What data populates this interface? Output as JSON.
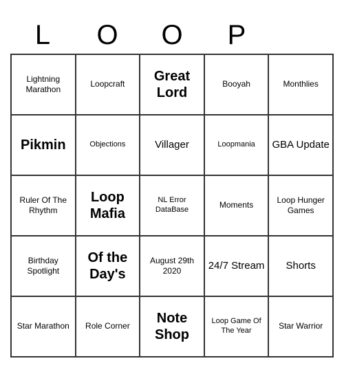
{
  "header": {
    "letters": [
      "L",
      "O",
      "O",
      "P",
      ""
    ]
  },
  "cells": [
    [
      {
        "text": "Lightning Marathon",
        "size": "size-small"
      },
      {
        "text": "Loopcraft",
        "size": "size-small"
      },
      {
        "text": "Great Lord",
        "size": "size-large"
      },
      {
        "text": "Booyah",
        "size": "size-small"
      },
      {
        "text": "Monthlies",
        "size": "size-small"
      }
    ],
    [
      {
        "text": "Pikmin",
        "size": "size-large"
      },
      {
        "text": "Objections",
        "size": "size-xsmall"
      },
      {
        "text": "Villager",
        "size": "size-medium"
      },
      {
        "text": "Loopmania",
        "size": "size-xsmall"
      },
      {
        "text": "GBA Update",
        "size": "size-medium"
      }
    ],
    [
      {
        "text": "Ruler Of The Rhythm",
        "size": "size-small"
      },
      {
        "text": "Loop Mafia",
        "size": "size-large"
      },
      {
        "text": "NL Error DataBase",
        "size": "size-xsmall"
      },
      {
        "text": "Moments",
        "size": "size-small"
      },
      {
        "text": "Loop Hunger Games",
        "size": "size-small"
      }
    ],
    [
      {
        "text": "Birthday Spotlight",
        "size": "size-small"
      },
      {
        "text": "Of the Day's",
        "size": "size-large"
      },
      {
        "text": "August 29th 2020",
        "size": "size-small"
      },
      {
        "text": "24/7 Stream",
        "size": "size-medium"
      },
      {
        "text": "Shorts",
        "size": "size-medium"
      }
    ],
    [
      {
        "text": "Star Marathon",
        "size": "size-small"
      },
      {
        "text": "Role Corner",
        "size": "size-small"
      },
      {
        "text": "Note Shop",
        "size": "size-large"
      },
      {
        "text": "Loop Game Of The Year",
        "size": "size-xsmall"
      },
      {
        "text": "Star Warrior",
        "size": "size-small"
      }
    ]
  ]
}
